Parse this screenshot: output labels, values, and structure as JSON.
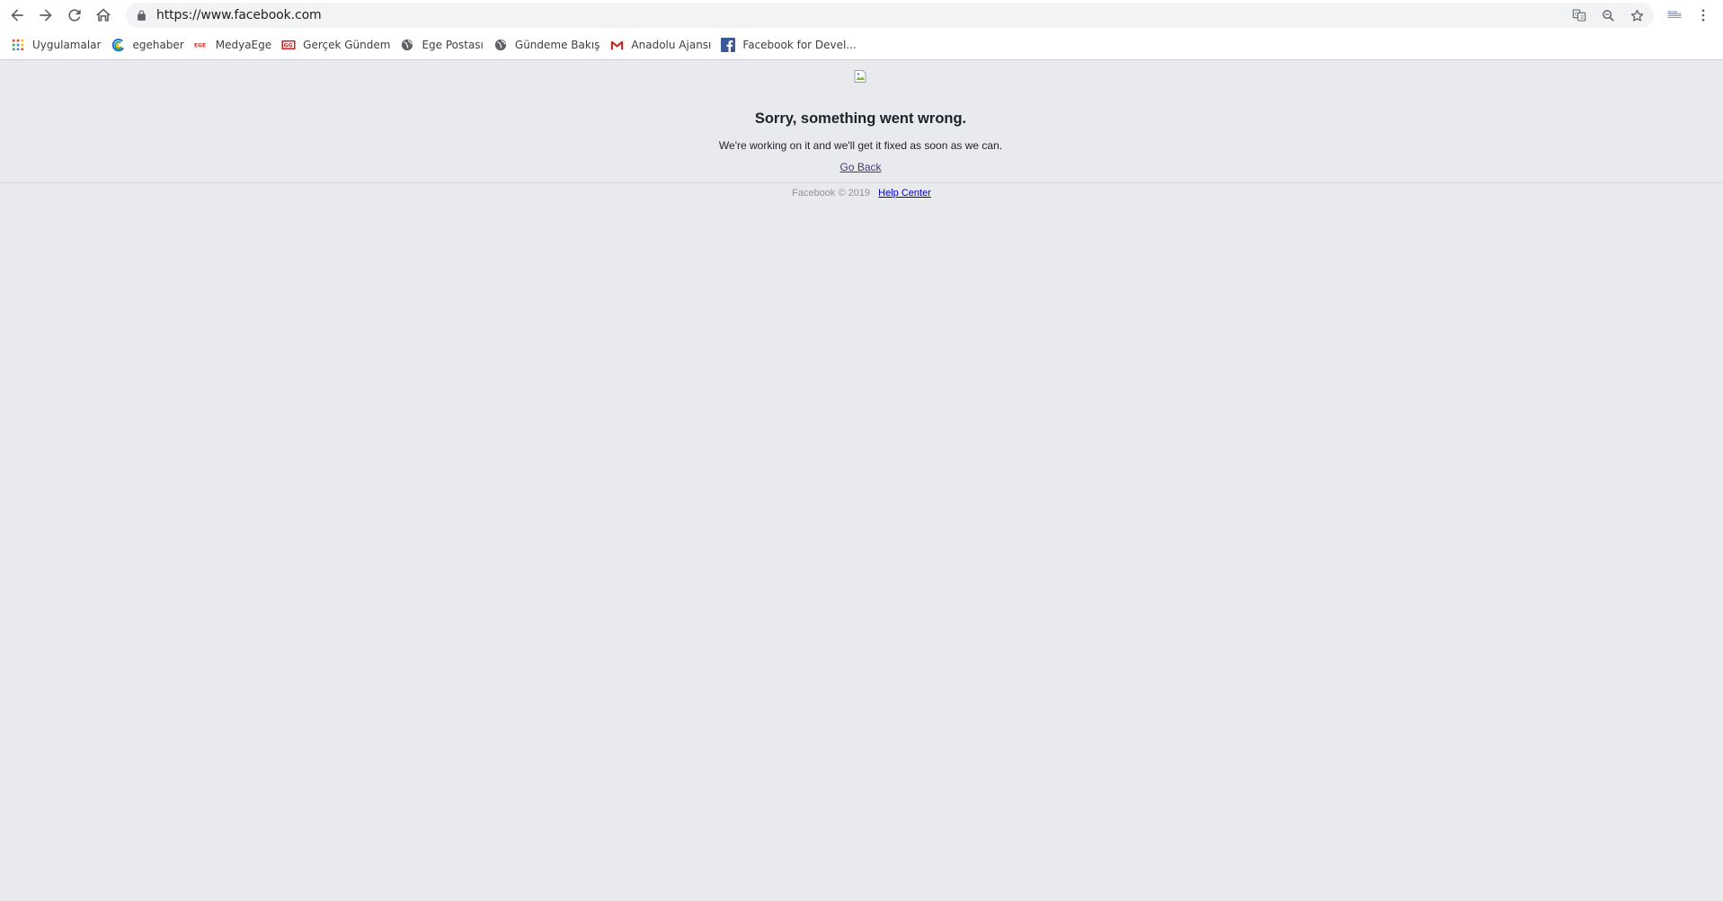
{
  "browser": {
    "url": "https://www.facebook.com",
    "bookmarks": [
      {
        "label": "Uygulamalar",
        "icon": "apps-grid-icon"
      },
      {
        "label": "egehaber",
        "icon": "egehaber-icon"
      },
      {
        "label": "MedyaEge",
        "icon": "medyaege-icon"
      },
      {
        "label": "Gerçek Gündem",
        "icon": "gercek-gundem-icon"
      },
      {
        "label": "Ege Postası",
        "icon": "globe-icon"
      },
      {
        "label": "Gündeme Bakış",
        "icon": "globe-icon"
      },
      {
        "label": "Anadolu Ajansı",
        "icon": "gmail-icon"
      },
      {
        "label": "Facebook for Devel...",
        "icon": "facebook-icon"
      }
    ],
    "colors": {
      "toolbar": "#ffffff",
      "omnibox": "#f1f3f4",
      "page_bg": "#e9eaed"
    }
  },
  "page": {
    "title": "Sorry, something went wrong.",
    "message": "We're working on it and we'll get it fixed as soon as we can.",
    "go_back": "Go Back",
    "footer_copyright": "Facebook © 2019",
    "footer_help": "Help Center",
    "colors": {
      "link_visited": "#4b367c",
      "link": "#0000cc",
      "footer_text": "#90949c"
    }
  }
}
